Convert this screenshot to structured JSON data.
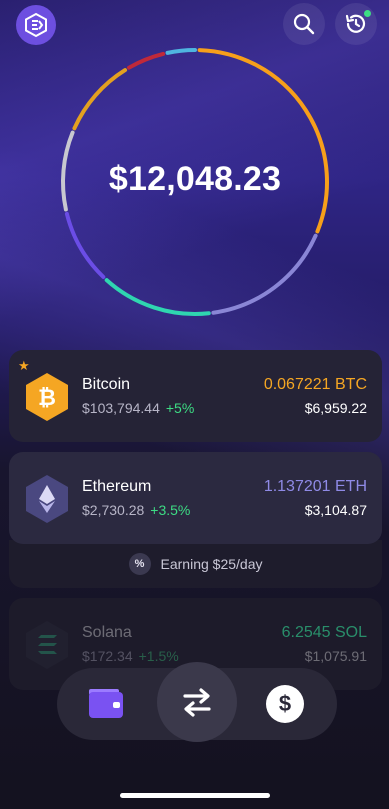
{
  "portfolio": {
    "total_balance": "$12,048.23"
  },
  "header": {
    "logo_icon": "exodus-logo-icon",
    "search_icon": "search-icon",
    "history_icon": "history-icon",
    "history_has_notification": true
  },
  "ring_colors": [
    "#f79f1a",
    "#8a86d6",
    "#2fd6b0",
    "#6b4de6",
    "#c8c8d0",
    "#e3a020",
    "#c0293a",
    "#4fb5e0"
  ],
  "assets": [
    {
      "name": "Bitcoin",
      "price": "$103,794.44",
      "change": "+5%",
      "amount": "0.067221 BTC",
      "value": "$6,959.22",
      "favorite": true,
      "icon": "bitcoin-icon",
      "color": "#f5a623"
    },
    {
      "name": "Ethereum",
      "price": "$2,730.28",
      "change": "+3.5%",
      "amount": "1.137201 ETH",
      "value": "$3,104.87",
      "favorite": false,
      "icon": "ethereum-icon",
      "color": "#8f8ae6",
      "earning": "Earning $25/day",
      "earning_icon_text": "%"
    },
    {
      "name": "Solana",
      "price": "$172.34",
      "change": "+1.5%",
      "amount": "6.2545 SOL",
      "value": "$1,075.91",
      "favorite": false,
      "icon": "solana-icon",
      "color": "#2fbf86"
    }
  ],
  "nav": {
    "wallet_icon": "wallet-icon",
    "swap_icon": "swap-icon",
    "dollar_icon": "dollar-icon",
    "dollar_symbol": "$"
  },
  "colors": {
    "accent": "#6d4fe0",
    "positive": "#3ddc84"
  }
}
